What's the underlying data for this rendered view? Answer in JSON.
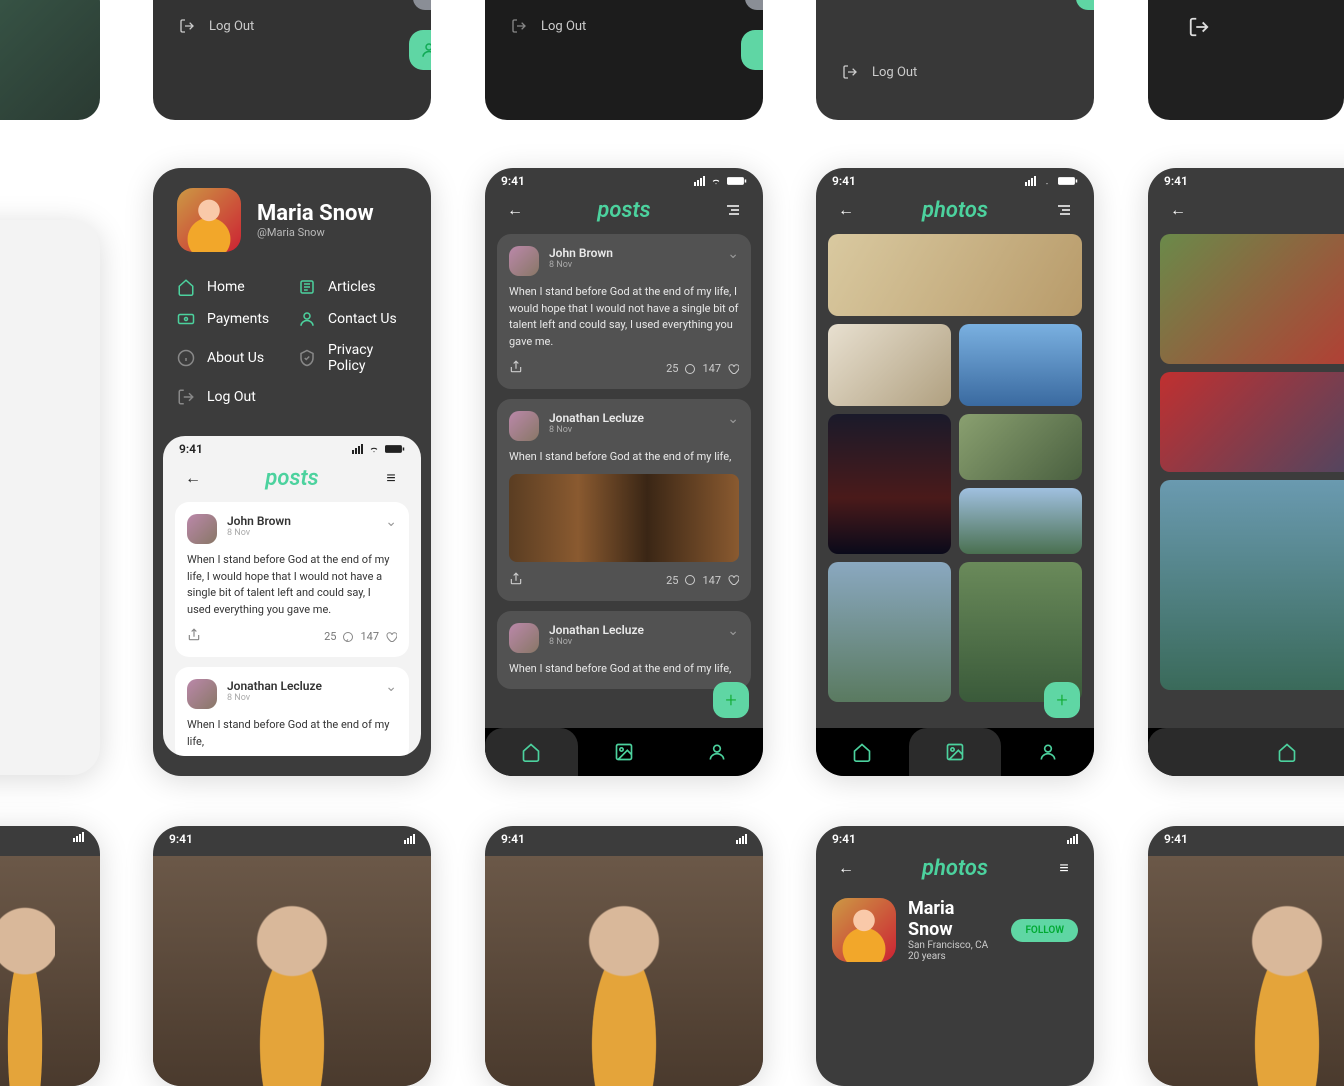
{
  "status_time": "9:41",
  "logout_label": "Log Out",
  "profile": {
    "name": "Maria Snow",
    "handle": "@Maria Snow",
    "location": "San Francisco, CA",
    "age": "20 years"
  },
  "menu": {
    "home": "Home",
    "articles": "Articles",
    "payments": "Payments",
    "contact": "Contact Us",
    "about": "About Us",
    "privacy": "Privacy Policy",
    "logout": "Log Out"
  },
  "titles": {
    "posts": "posts",
    "photos": "photos"
  },
  "posts": [
    {
      "author": "John Brown",
      "date": "8 Nov",
      "text": "When I stand before God at the end of my life, I would hope that I would not have a single bit of talent left and could say, I used everything you gave me.",
      "comments": "25",
      "likes": "147"
    },
    {
      "author": "Jonathan Lecluze",
      "date": "8 Nov",
      "text": "When I stand before God at the end of my life,",
      "comments": "25",
      "likes": "147"
    },
    {
      "author": "Jonathan Lecluze",
      "date": "8 Nov",
      "text": "When I stand before God at the end of my life,",
      "comments": "",
      "likes": ""
    }
  ],
  "follow_label": "FOLLOW"
}
